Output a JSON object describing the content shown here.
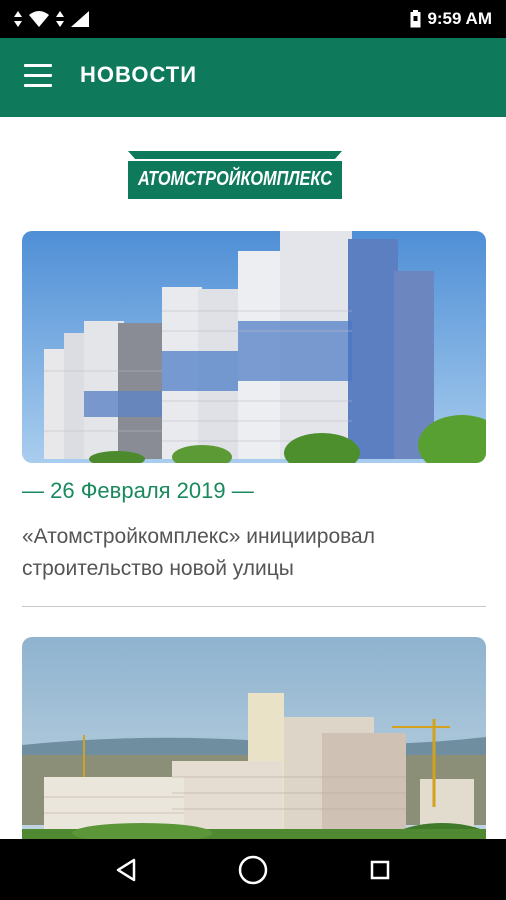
{
  "status_bar": {
    "time": "9:59 AM",
    "icons": [
      "data-arrows-icon",
      "wifi-icon",
      "data-arrows-icon",
      "signal-icon",
      "battery-icon"
    ]
  },
  "app_bar": {
    "title": "НОВОСТИ",
    "menu_icon": "hamburger-menu-icon",
    "color": "#0e7a5b"
  },
  "logo": {
    "text": "АТОМСТРОЙКОМПЛЕКС",
    "color": "#0e7a5b"
  },
  "news": [
    {
      "date": "— 26 Февраля 2019 —",
      "title": "«Атомстройкомплекс» инициировал строительство новой улицы",
      "image": "high-rise-buildings-photo"
    },
    {
      "image": "city-panorama-photo"
    }
  ],
  "nav_bar": {
    "buttons": [
      "back-icon",
      "home-icon",
      "recents-icon"
    ]
  },
  "colors": {
    "accent": "#0e7a5b",
    "date_text": "#1a8a5e",
    "title_text": "#555555"
  }
}
